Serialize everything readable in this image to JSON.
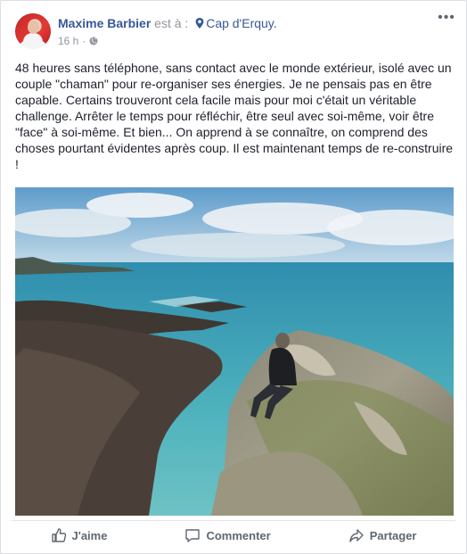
{
  "post": {
    "author": "Maxime Barbier",
    "at_label": "est à :",
    "place": "Cap d'Erquy.",
    "time": "16 h",
    "text": "48 heures sans téléphone, sans contact avec le monde extérieur, isolé avec un couple \"chaman\" pour re-organiser ses énergies. Je ne pensais pas en être capable. Certains trouveront cela facile mais pour moi c'était un véritable challenge. Arrêter le temps pour réfléchir, être seul avec soi-même, voir être \"face\" à soi-même. Et bien... On apprend à se connaître, on comprend des choses pourtant évidentes après coup. Il est maintenant temps de re-construire !"
  },
  "actions": {
    "like": "J'aime",
    "comment": "Commenter",
    "share": "Partager"
  },
  "icons": {
    "more": "more-options-icon",
    "place": "location-pin-icon",
    "privacy": "globe-icon",
    "like": "thumbs-up-icon",
    "comment": "speech-bubble-icon",
    "share": "share-arrow-icon"
  },
  "colors": {
    "link": "#365899",
    "meta": "#90949c",
    "action": "#606770"
  }
}
